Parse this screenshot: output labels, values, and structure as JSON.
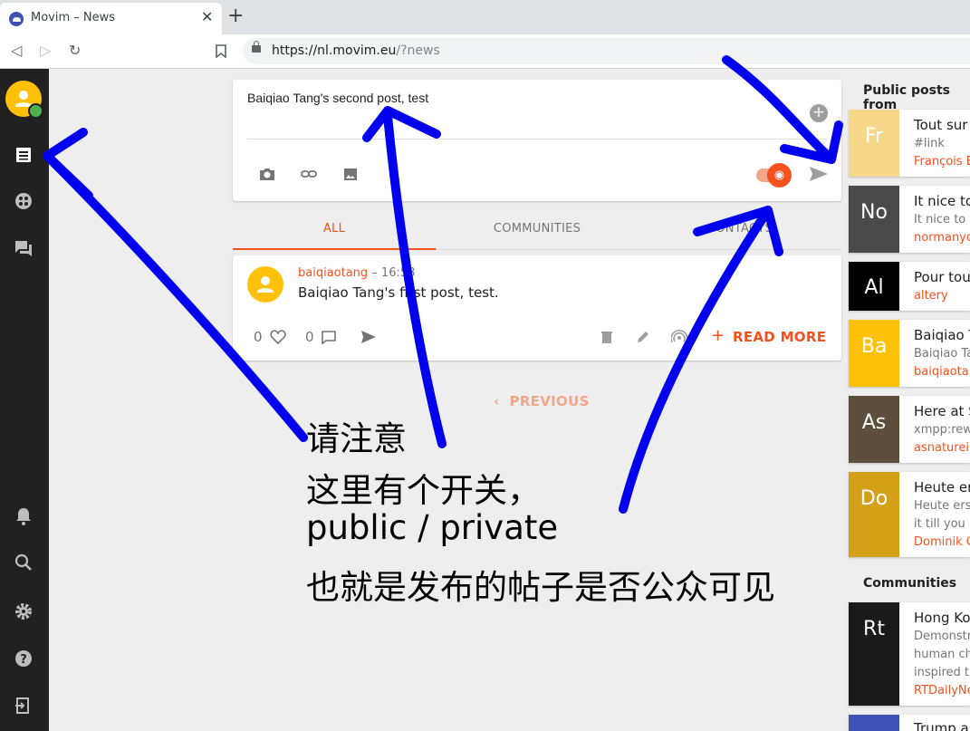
{
  "browser": {
    "tab_title": "Movim – News",
    "close_glyph": "✕",
    "new_tab_glyph": "+",
    "url_host": "https://nl.movim.eu",
    "url_path": "/?news",
    "back_glyph": "◁",
    "forward_glyph": "▷",
    "reload_glyph": "↻",
    "bookmark_glyph": "🔖"
  },
  "sidebar": {
    "icons": [
      "news-icon",
      "explore-icon",
      "chat-icon",
      "bell-icon",
      "search-icon",
      "gear-icon",
      "help-icon",
      "logout-icon"
    ]
  },
  "compose": {
    "text": "Baiqiao Tang's second post, test",
    "add_glyph": "+",
    "icons": [
      "camera-icon",
      "link-icon",
      "image-icon",
      "public-toggle",
      "send-icon"
    ]
  },
  "tabs": [
    "ALL",
    "COMMUNITIES",
    "CONTACTS"
  ],
  "post": {
    "author": "baiqiaotang",
    "time": " – 16:58",
    "body": "Baiqiao Tang's first post, test.",
    "likes": "0",
    "comments": "0",
    "read_more": "READ MORE",
    "plus_glyph": "+"
  },
  "previous_label": "PREVIOUS",
  "previous_glyph": "‹",
  "right_panel": {
    "public_header": "Public posts from",
    "communities_header": "Communities",
    "posts": [
      {
        "initials": "Fr",
        "title": "Tout sur",
        "sub": "#link",
        "author": "François E",
        "color": "#f7d88b"
      },
      {
        "initials": "No",
        "title": "It nice to",
        "sub": "It nice to r",
        "author": "normanyo",
        "color": "#4a4a4a"
      },
      {
        "initials": "Al",
        "title": "Pour tou",
        "sub": "",
        "author": "altery",
        "color": "#000000"
      },
      {
        "initials": "Ba",
        "title": "Baiqiao T",
        "sub": "Baiqiao Ta",
        "author": "baiqiaota",
        "color": "#ffc107"
      },
      {
        "initials": "As",
        "title": "Here at S",
        "sub": "xmpp:rew",
        "author": "asnaturei",
        "color": "#5d4e3c"
      },
      {
        "initials": "Do",
        "title": "Heute er",
        "sub": "Heute ers",
        "sub2": "it till you",
        "author": "Dominik G",
        "color": "#d4a017"
      }
    ],
    "communities": [
      {
        "initials": "Rt",
        "title": "Hong Ko",
        "sub": "Demonstr",
        "sub2": "human ch",
        "sub3": "inspired t",
        "author": "RTDailyNe",
        "color": "#1a1a1a"
      },
      {
        "initials": "",
        "title": "Trump a",
        "color": "#3f51b5"
      }
    ]
  },
  "annotation": {
    "line1": "请注意",
    "line2": "这里有个开关，",
    "line3": "public / private",
    "line4": "也就是发布的帖子是否公众可见",
    "color": "#0000ee"
  }
}
